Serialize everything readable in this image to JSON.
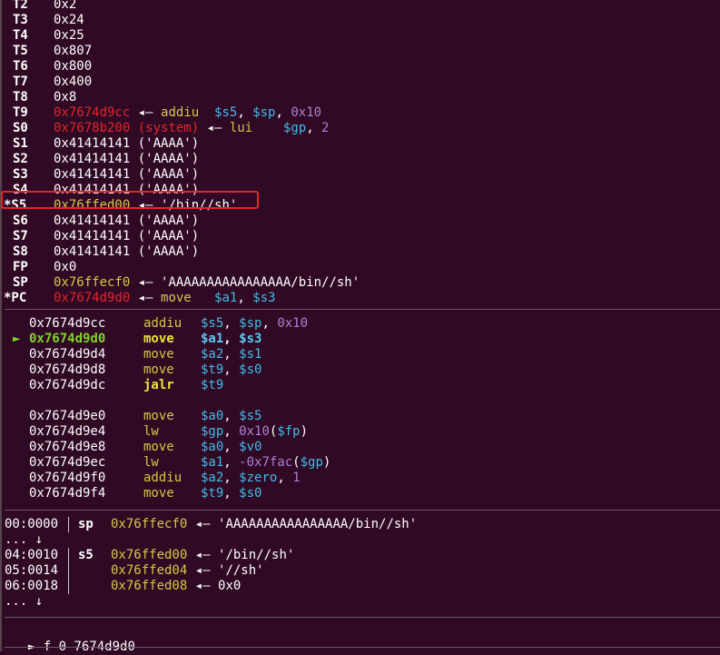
{
  "registers": [
    {
      "name": "T2",
      "value": "0x2",
      "star": false,
      "vcolor": "wht",
      "tail": []
    },
    {
      "name": "T3",
      "value": "0x24",
      "star": false,
      "vcolor": "wht",
      "tail": []
    },
    {
      "name": "T4",
      "value": "0x25",
      "star": false,
      "vcolor": "wht",
      "tail": []
    },
    {
      "name": "T5",
      "value": "0x807",
      "star": false,
      "vcolor": "wht",
      "tail": []
    },
    {
      "name": "T6",
      "value": "0x800",
      "star": false,
      "vcolor": "wht",
      "tail": []
    },
    {
      "name": "T7",
      "value": "0x400",
      "star": false,
      "vcolor": "wht",
      "tail": []
    },
    {
      "name": "T8",
      "value": "0x8",
      "star": false,
      "vcolor": "wht",
      "tail": []
    },
    {
      "name": "T9",
      "value": "0x7674d9cc",
      "star": false,
      "vcolor": "red",
      "tail": [
        {
          "t": " ◂— ",
          "c": "wht"
        },
        {
          "t": "addiu  ",
          "c": "yel"
        },
        {
          "t": "$s5",
          "c": "cyan"
        },
        {
          "t": ", ",
          "c": "wht"
        },
        {
          "t": "$sp",
          "c": "cyan"
        },
        {
          "t": ", ",
          "c": "wht"
        },
        {
          "t": "0x10",
          "c": "purp"
        }
      ]
    },
    {
      "name": "S0",
      "value": "0x7678b200",
      "star": false,
      "vcolor": "red",
      "tail": [
        {
          "t": " (system)",
          "c": "red"
        },
        {
          "t": " ◂— ",
          "c": "wht"
        },
        {
          "t": "lui    ",
          "c": "yel"
        },
        {
          "t": "$gp",
          "c": "cyan"
        },
        {
          "t": ", ",
          "c": "wht"
        },
        {
          "t": "2",
          "c": "purp"
        }
      ]
    },
    {
      "name": "S1",
      "value": "0x41414141 ('AAAA')",
      "star": false,
      "vcolor": "wht",
      "tail": []
    },
    {
      "name": "S2",
      "value": "0x41414141 ('AAAA')",
      "star": false,
      "vcolor": "wht",
      "tail": []
    },
    {
      "name": "S3",
      "value": "0x41414141 ('AAAA')",
      "star": false,
      "vcolor": "wht",
      "tail": []
    },
    {
      "name": "S4",
      "value": "0x41414141 ('AAAA')",
      "star": false,
      "vcolor": "wht",
      "tail": []
    },
    {
      "name": "*S5",
      "value": "0x76ffed00",
      "star": true,
      "vcolor": "yel",
      "tail": [
        {
          "t": " ◂— ",
          "c": "wht"
        },
        {
          "t": "'/bin//sh'",
          "c": "wht"
        }
      ]
    },
    {
      "name": "S6",
      "value": "0x41414141 ('AAAA')",
      "star": false,
      "vcolor": "wht",
      "tail": []
    },
    {
      "name": "S7",
      "value": "0x41414141 ('AAAA')",
      "star": false,
      "vcolor": "wht",
      "tail": []
    },
    {
      "name": "S8",
      "value": "0x41414141 ('AAAA')",
      "star": false,
      "vcolor": "wht",
      "tail": []
    },
    {
      "name": "FP",
      "value": "0x0",
      "star": false,
      "vcolor": "wht",
      "tail": []
    },
    {
      "name": "SP",
      "value": "0x76ffecf0",
      "star": false,
      "vcolor": "yel",
      "tail": [
        {
          "t": " ◂— ",
          "c": "wht"
        },
        {
          "t": "'AAAAAAAAAAAAAAAA/bin//sh'",
          "c": "wht"
        }
      ]
    },
    {
      "name": "*PC",
      "value": "0x7674d9d0",
      "star": true,
      "vcolor": "red",
      "tail": [
        {
          "t": " ◂— ",
          "c": "wht"
        },
        {
          "t": "move   ",
          "c": "yel"
        },
        {
          "t": "$a1",
          "c": "cyan"
        },
        {
          "t": ", ",
          "c": "wht"
        },
        {
          "t": "$s3",
          "c": "cyan"
        }
      ]
    }
  ],
  "disasm": [
    {
      "addr": "0x7674d9cc",
      "mnem": "addiu",
      "ops": [
        {
          "t": "$s5",
          "c": "cyan"
        },
        {
          "t": ", ",
          "c": "wht"
        },
        {
          "t": "$sp",
          "c": "cyan"
        },
        {
          "t": ", ",
          "c": "wht"
        },
        {
          "t": "0x10",
          "c": "purp"
        }
      ],
      "current": false,
      "bold": false
    },
    {
      "addr": "0x7674d9d0",
      "mnem": "move",
      "ops": [
        {
          "t": "$a1",
          "c": "cyan"
        },
        {
          "t": ", ",
          "c": "wht"
        },
        {
          "t": "$s3",
          "c": "cyan"
        }
      ],
      "current": true,
      "bold": true
    },
    {
      "addr": "0x7674d9d4",
      "mnem": "move",
      "ops": [
        {
          "t": "$a2",
          "c": "cyan"
        },
        {
          "t": ", ",
          "c": "wht"
        },
        {
          "t": "$s1",
          "c": "cyan"
        }
      ],
      "current": false,
      "bold": false
    },
    {
      "addr": "0x7674d9d8",
      "mnem": "move",
      "ops": [
        {
          "t": "$t9",
          "c": "cyan"
        },
        {
          "t": ", ",
          "c": "wht"
        },
        {
          "t": "$s0",
          "c": "cyan"
        }
      ],
      "current": false,
      "bold": false
    },
    {
      "addr": "0x7674d9dc",
      "mnem": "jalr",
      "ops": [
        {
          "t": "$t9",
          "c": "cyan"
        }
      ],
      "current": false,
      "bold": false,
      "mbold": true
    },
    {
      "addr": "0x7674d9e0",
      "mnem": "move",
      "ops": [
        {
          "t": "$a0",
          "c": "cyan"
        },
        {
          "t": ", ",
          "c": "wht"
        },
        {
          "t": "$s5",
          "c": "cyan"
        }
      ],
      "current": false,
      "bold": false
    },
    {
      "addr": "0x7674d9e4",
      "mnem": "lw",
      "ops": [
        {
          "t": "$gp",
          "c": "cyan"
        },
        {
          "t": ", ",
          "c": "wht"
        },
        {
          "t": "0x10",
          "c": "purp"
        },
        {
          "t": "(",
          "c": "wht"
        },
        {
          "t": "$fp",
          "c": "cyan"
        },
        {
          "t": ")",
          "c": "wht"
        }
      ],
      "current": false,
      "bold": false
    },
    {
      "addr": "0x7674d9e8",
      "mnem": "move",
      "ops": [
        {
          "t": "$a0",
          "c": "cyan"
        },
        {
          "t": ", ",
          "c": "wht"
        },
        {
          "t": "$v0",
          "c": "cyan"
        }
      ],
      "current": false,
      "bold": false
    },
    {
      "addr": "0x7674d9ec",
      "mnem": "lw",
      "ops": [
        {
          "t": "$a1",
          "c": "cyan"
        },
        {
          "t": ", ",
          "c": "wht"
        },
        {
          "t": "-0x7fac",
          "c": "purp"
        },
        {
          "t": "(",
          "c": "wht"
        },
        {
          "t": "$gp",
          "c": "cyan"
        },
        {
          "t": ")",
          "c": "wht"
        }
      ],
      "current": false,
      "bold": false
    },
    {
      "addr": "0x7674d9f0",
      "mnem": "addiu",
      "ops": [
        {
          "t": "$a2",
          "c": "cyan"
        },
        {
          "t": ", ",
          "c": "wht"
        },
        {
          "t": "$zero",
          "c": "cyan"
        },
        {
          "t": ", ",
          "c": "wht"
        },
        {
          "t": "1",
          "c": "purp"
        }
      ],
      "current": false,
      "bold": false
    },
    {
      "addr": "0x7674d9f4",
      "mnem": "move",
      "ops": [
        {
          "t": "$t9",
          "c": "cyan"
        },
        {
          "t": ", ",
          "c": "wht"
        },
        {
          "t": "$s0",
          "c": "cyan"
        }
      ],
      "current": false,
      "bold": false
    }
  ],
  "stack": [
    {
      "off": "00:0000",
      "reg": "sp",
      "val": "0x76ffecf0",
      "arrow": " ◂— ",
      "deref": "'AAAAAAAAAAAAAAAA/bin//sh'",
      "kind": "row"
    },
    {
      "text": "... ↓",
      "kind": "ellipsis"
    },
    {
      "off": "04:0010",
      "reg": "s5",
      "val": "0x76ffed00",
      "arrow": " ◂— ",
      "deref": "'/bin//sh'",
      "kind": "row"
    },
    {
      "off": "05:0014",
      "reg": "",
      "val": "0x76ffed04",
      "arrow": " ◂— ",
      "deref": "'//sh'",
      "kind": "row"
    },
    {
      "off": "06:0018",
      "reg": "",
      "val": "0x76ffed08",
      "arrow": " ◂— ",
      "deref": "0x0",
      "kind": "row"
    },
    {
      "text": "... ↓",
      "kind": "ellipsis"
    }
  ],
  "backtrace": {
    "marker": "►",
    "text": " f 0 7674d9d0"
  },
  "cursor_marker": "►",
  "colors": {
    "bg": "#300a24",
    "red": "#e0262a",
    "yellow": "#d7c64a",
    "cyan": "#45b9e8",
    "purple": "#ad7fd6",
    "green": "#7fd22c",
    "highlight_box": "#e8242a"
  }
}
